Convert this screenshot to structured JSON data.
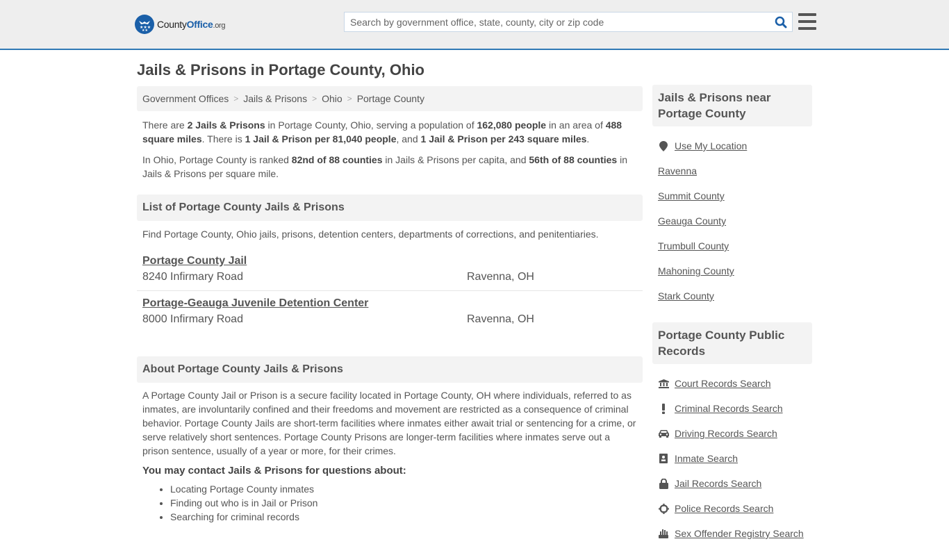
{
  "header": {
    "logo": {
      "part1": "County",
      "part2": "Office",
      "part3": ".org"
    },
    "search": {
      "placeholder": "Search by government office, state, county, city or zip code",
      "value": ""
    }
  },
  "page": {
    "title": "Jails & Prisons in Portage County, Ohio"
  },
  "breadcrumb": [
    {
      "label": "Government Offices"
    },
    {
      "label": "Jails & Prisons"
    },
    {
      "label": "Ohio"
    },
    {
      "label": "Portage County"
    }
  ],
  "summary": {
    "p1": {
      "t1": "There are ",
      "b1": "2 Jails & Prisons",
      "t2": " in Portage County, Ohio, serving a population of ",
      "b2": "162,080 people",
      "t3": " in an area of ",
      "b3": "488 square miles",
      "t4": ". There is ",
      "b4": "1 Jail & Prison per 81,040 people",
      "t5": ", and ",
      "b5": "1 Jail & Prison per 243 square miles",
      "t6": "."
    },
    "p2": {
      "t1": "In Ohio, Portage County is ranked ",
      "b1": "82nd of 88 counties",
      "t2": " in Jails & Prisons per capita, and ",
      "b2": "56th of 88 counties",
      "t3": " in Jails & Prisons per square mile."
    }
  },
  "list_section": {
    "heading": "List of Portage County Jails & Prisons",
    "description": "Find Portage County, Ohio jails, prisons, detention centers, departments of corrections, and penitentiaries.",
    "facilities": [
      {
        "name": "Portage County Jail",
        "address": "8240 Infirmary Road",
        "city": "Ravenna, OH"
      },
      {
        "name": "Portage-Geauga Juvenile Detention Center",
        "address": "8000 Infirmary Road",
        "city": "Ravenna, OH"
      }
    ]
  },
  "about_section": {
    "heading": "About Portage County Jails & Prisons",
    "text": "A Portage County Jail or Prison is a secure facility located in Portage County, OH where individuals, referred to as inmates, are involuntarily confined and their freedoms and movement are restricted as a consequence of criminal behavior. Portage County Jails are short-term facilities where inmates either await trial or sentencing for a crime, or serve relatively short sentences. Portage County Prisons are longer-term facilities where inmates serve out a prison sentence, usually of a year or more, for their crimes.",
    "contact_heading": "You may contact Jails & Prisons for questions about:",
    "contact_items": [
      "Locating Portage County inmates",
      "Finding out who is in Jail or Prison",
      "Searching for criminal records"
    ]
  },
  "sidebar": {
    "nearby": {
      "heading": "Jails & Prisons near Portage County",
      "use_location": "Use My Location",
      "items": [
        "Ravenna",
        "Summit County",
        "Geauga County",
        "Trumbull County",
        "Mahoning County",
        "Stark County"
      ]
    },
    "records": {
      "heading": "Portage County Public Records",
      "items": [
        {
          "label": "Court Records Search",
          "icon": "courthouse-icon"
        },
        {
          "label": "Criminal Records Search",
          "icon": "exclamation-icon"
        },
        {
          "label": "Driving Records Search",
          "icon": "car-icon"
        },
        {
          "label": "Inmate Search",
          "icon": "id-badge-icon"
        },
        {
          "label": "Jail Records Search",
          "icon": "lock-icon"
        },
        {
          "label": "Police Records Search",
          "icon": "crosshairs-icon"
        },
        {
          "label": "Sex Offender Registry Search",
          "icon": "hand-icon"
        }
      ]
    }
  },
  "colors": {
    "brand": "#1a5fa8",
    "header_border": "#3079b5",
    "panel_bg": "#f3f3f3",
    "text": "#555555"
  }
}
